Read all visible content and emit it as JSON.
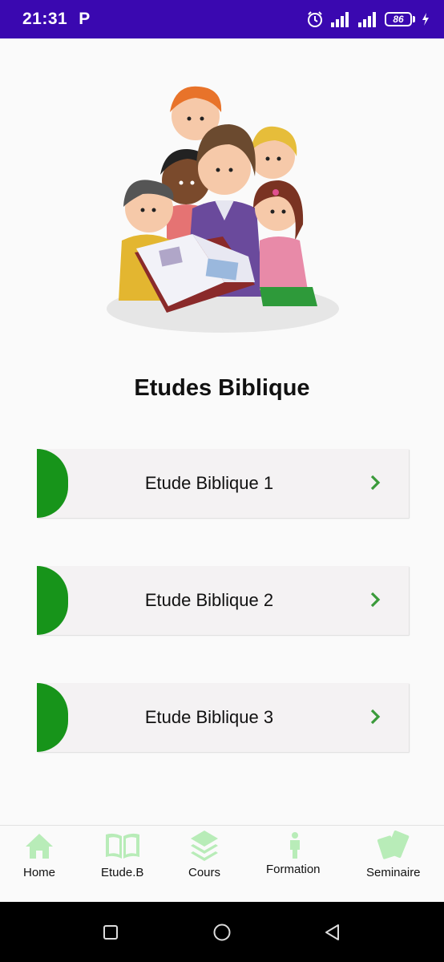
{
  "status_bar": {
    "time": "21:31",
    "notification_letter": "P",
    "battery_level": "86",
    "background": "#3a08b0"
  },
  "page": {
    "title": "Etudes Biblique"
  },
  "cards": [
    {
      "label": "Etude Biblique 1"
    },
    {
      "label": "Etude Biblique 2"
    },
    {
      "label": "Etude Biblique 3"
    }
  ],
  "colors": {
    "accent_green": "#17941a",
    "chevron_green": "#3a9a3a",
    "nav_icon_green": "#b8ecb8"
  },
  "bottom_nav": {
    "items": [
      {
        "label": "Home",
        "icon": "home-icon"
      },
      {
        "label": "Etude.B",
        "icon": "book-icon"
      },
      {
        "label": "Cours",
        "icon": "layers-icon"
      },
      {
        "label": "Formation",
        "icon": "person-icon"
      },
      {
        "label": "Seminaire",
        "icon": "cards-icon"
      }
    ]
  },
  "system_nav": {
    "icons": [
      "recent-apps-icon",
      "home-circle-icon",
      "back-triangle-icon"
    ]
  }
}
